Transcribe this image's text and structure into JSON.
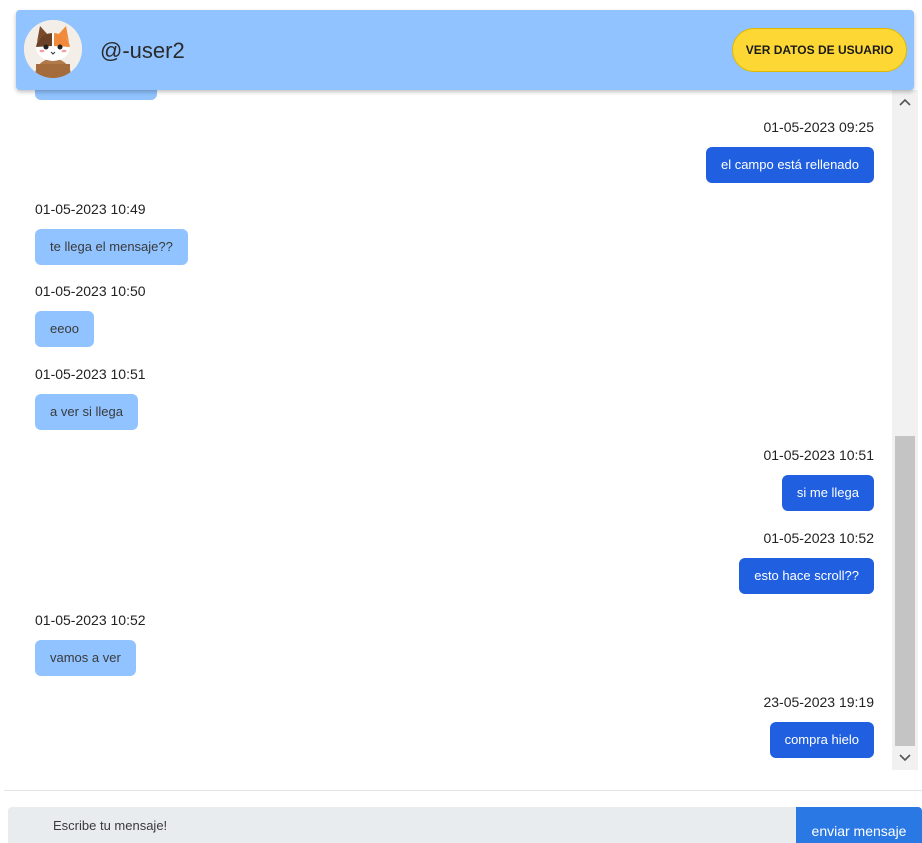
{
  "header": {
    "username": "@-user2",
    "user_data_button": "VER DATOS DE USUARIO"
  },
  "messages": [
    {
      "direction": "out",
      "timestamp": "01-05-2023 09:25",
      "text": "el campo está rellenado"
    },
    {
      "direction": "in",
      "timestamp": "01-05-2023 10:49",
      "text": "te llega el mensaje??"
    },
    {
      "direction": "in",
      "timestamp": "01-05-2023 10:50",
      "text": "eeoo"
    },
    {
      "direction": "in",
      "timestamp": "01-05-2023 10:51",
      "text": "a ver si llega"
    },
    {
      "direction": "out",
      "timestamp": "01-05-2023 10:51",
      "text": "si me llega"
    },
    {
      "direction": "out",
      "timestamp": "01-05-2023 10:52",
      "text": "esto hace scroll??"
    },
    {
      "direction": "in",
      "timestamp": "01-05-2023 10:52",
      "text": "vamos a ver"
    },
    {
      "direction": "out",
      "timestamp": "23-05-2023 19:19",
      "text": "compra hielo"
    }
  ],
  "composer": {
    "placeholder": "Escribe tu mensaje!",
    "value": "",
    "send_label": "enviar mensaje"
  },
  "colors": {
    "header_bg": "#90c3ff",
    "incoming_bubble": "#90c3ff",
    "outgoing_bubble": "#1f5fe0",
    "user_button": "#fdd835",
    "send_button": "#2a78e4"
  },
  "icons": {
    "avatar": "cat-avatar-icon",
    "scroll_up": "chevron-up-icon",
    "scroll_down": "chevron-down-icon"
  }
}
